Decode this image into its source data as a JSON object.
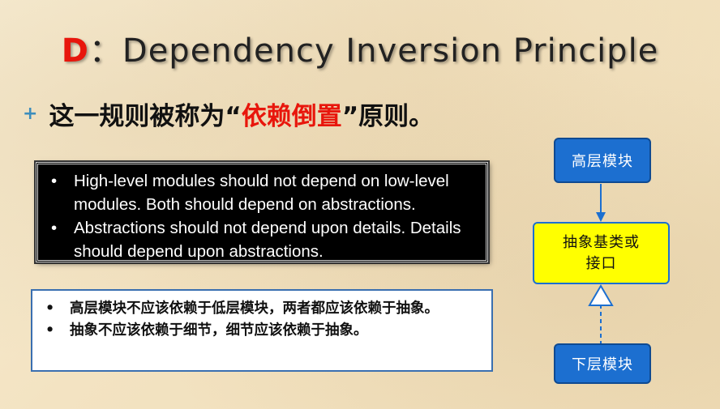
{
  "title": {
    "letter": "D",
    "rest": "：Dependency Inversion Principle"
  },
  "bullet": {
    "prefix": "这一规则被称为“",
    "highlight": "依赖倒置",
    "suffix": "”原则。"
  },
  "english_box": {
    "items": [
      "High-level modules should not depend on low-level modules. Both should depend on abstractions.",
      "Abstractions should not depend upon details. Details should depend upon abstractions."
    ]
  },
  "chinese_box": {
    "items": [
      "高层模块不应该依赖于低层模块，两者都应该依赖于抽象。",
      "抽象不应该依赖于细节，细节应该依赖于抽象。"
    ]
  },
  "diagram": {
    "top_node": "高层模块",
    "middle_node_line1": "抽象基类或",
    "middle_node_line2": "接口",
    "bottom_node": "下层模块"
  },
  "colors": {
    "accent_red": "#e8160c",
    "node_blue": "#1c6fd0",
    "node_yellow": "#ffff00",
    "plus_blue": "#3c8dbc"
  }
}
